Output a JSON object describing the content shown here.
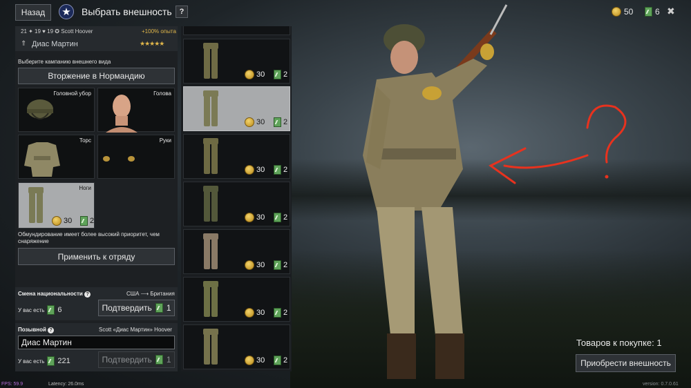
{
  "header": {
    "back_label": "Назад",
    "title": "Выбрать внешность",
    "help_label": "?",
    "coins": "50",
    "tickets": "6",
    "close_label": "✖"
  },
  "profile": {
    "stats": "21 ✦ 19 ♥ 19 ✪   Scott Hoover",
    "exp_bonus": "+100% опыта",
    "name": "Диас Мартин",
    "stars": "★★★★★"
  },
  "campaign": {
    "label": "Выберите кампанию внешнего вида",
    "button": "Вторжение в Нормандию"
  },
  "slots": {
    "headgear": "Головной убор",
    "head": "Голова",
    "torso": "Торс",
    "hands": "Руки",
    "legs": "Ноги",
    "legs_price": "30",
    "legs_tickets": "2"
  },
  "note": "Обмундирование имеет более высокий приоритет, чем снаряжение",
  "apply_label": "Применить к отряду",
  "nationality": {
    "title": "Смена национальности",
    "route": "США ⟶ Британия",
    "have_label": "У вас есть",
    "have_value": "6",
    "confirm_label": "Подтвердить",
    "confirm_cost": "1"
  },
  "callsign": {
    "title": "Позывной",
    "hint": "Scott «Диас Мартин» Hoover",
    "input_value": "Диас Мартин",
    "have_label": "У вас есть",
    "have_value": "221",
    "confirm_label": "Подтвердить",
    "confirm_cost": "1"
  },
  "items": [
    {
      "price": "30",
      "tickets": "2",
      "color": "#6f6b45"
    },
    {
      "price": "30",
      "tickets": "2",
      "color": "#7b7a55"
    },
    {
      "price": "30",
      "tickets": "2",
      "color": "#6e6a43"
    },
    {
      "price": "30",
      "tickets": "2",
      "color": "#53583a"
    },
    {
      "price": "30",
      "tickets": "2",
      "color": "#8a7a66"
    },
    {
      "price": "30",
      "tickets": "2",
      "color": "#6d7045"
    },
    {
      "price": "30",
      "tickets": "2",
      "color": "#76724c"
    }
  ],
  "purchase": {
    "to_buy": "Товаров к покупке: 1",
    "buy_label": "Приобрести внешность"
  },
  "footer": {
    "fps": "FPS: 59.9",
    "latency": "Latency: 26.0ms",
    "version": "version: 0.7.0.61"
  },
  "colors": {
    "accent_gold": "#e0b64a",
    "ticket_green": "#5fa35a",
    "annotation_red": "#e8321e"
  }
}
